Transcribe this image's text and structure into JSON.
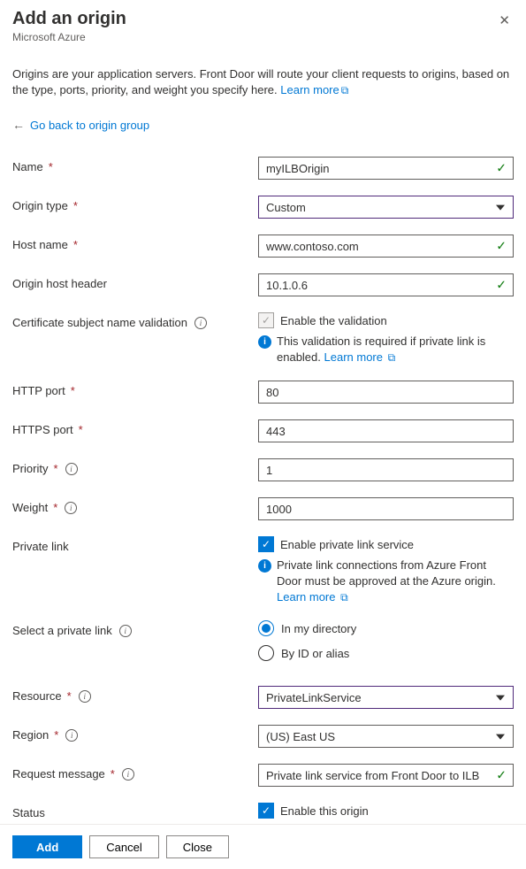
{
  "header": {
    "title": "Add an origin",
    "subtitle": "Microsoft Azure"
  },
  "description": {
    "text": "Origins are your application servers. Front Door will route your client requests to origins, based on the type, ports, priority, and weight you specify here. ",
    "learn_more": "Learn more"
  },
  "backlink": "Go back to origin group",
  "fields": {
    "name": {
      "label": "Name",
      "value": "myILBOrigin"
    },
    "origin_type": {
      "label": "Origin type",
      "value": "Custom"
    },
    "host_name": {
      "label": "Host name",
      "value": "www.contoso.com"
    },
    "origin_host_header": {
      "label": "Origin host header",
      "value": "10.1.0.6"
    },
    "cert_validation": {
      "label": "Certificate subject name validation",
      "checkbox_label": "Enable the validation",
      "info_text": "This validation is required if private link is enabled. ",
      "learn_more": "Learn more"
    },
    "http_port": {
      "label": "HTTP port",
      "value": "80"
    },
    "https_port": {
      "label": "HTTPS port",
      "value": "443"
    },
    "priority": {
      "label": "Priority",
      "value": "1"
    },
    "weight": {
      "label": "Weight",
      "value": "1000"
    },
    "private_link": {
      "label": "Private link",
      "checkbox_label": "Enable private link service",
      "info_text": "Private link connections from Azure Front Door must be approved at the Azure origin. ",
      "learn_more": "Learn more"
    },
    "select_private_link": {
      "label": "Select a private link",
      "option_in_directory": "In my directory",
      "option_by_id": "By ID or alias"
    },
    "resource": {
      "label": "Resource",
      "value": "PrivateLinkService"
    },
    "region": {
      "label": "Region",
      "value": "(US) East US"
    },
    "request_message": {
      "label": "Request message",
      "value": "Private link service from Front Door to ILB"
    },
    "status": {
      "label": "Status",
      "checkbox_label": "Enable this origin"
    }
  },
  "footer": {
    "add": "Add",
    "cancel": "Cancel",
    "close": "Close"
  }
}
